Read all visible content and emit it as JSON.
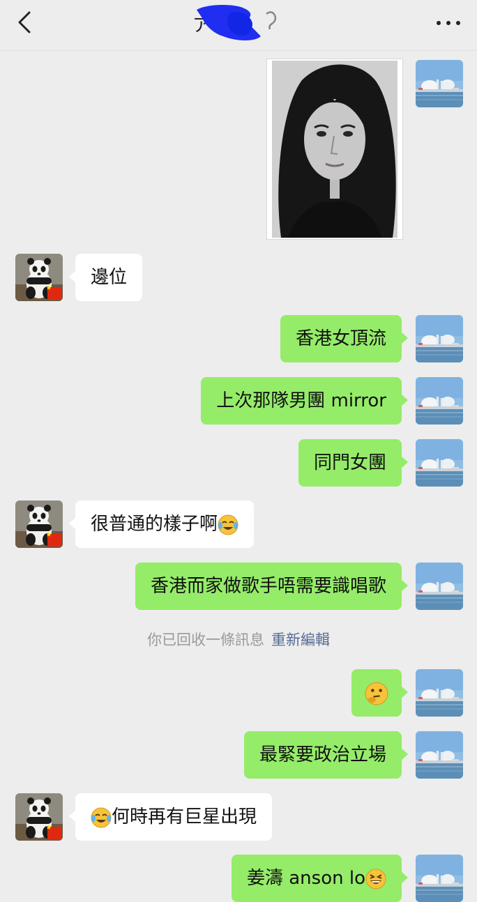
{
  "header": {
    "title_fragment": "ア",
    "back_icon": "chevron-left-icon",
    "ear_icon": "ear-icon",
    "more_icon": "more-dots-icon"
  },
  "messages": [
    {
      "side": "me",
      "type": "image",
      "content": "photo of a woman"
    },
    {
      "side": "other",
      "type": "text",
      "text": "邊位"
    },
    {
      "side": "me",
      "type": "text",
      "text": "香港女頂流"
    },
    {
      "side": "me",
      "type": "text",
      "text": "上次那隊男團 mirror"
    },
    {
      "side": "me",
      "type": "text",
      "text": "同門女團"
    },
    {
      "side": "other",
      "type": "text",
      "text": "很普通的樣子啊",
      "trailing_emoji": "crying-laughing-emoji"
    },
    {
      "side": "me",
      "type": "text",
      "text": "香港而家做歌手唔需要識唱歌"
    },
    {
      "side": "me",
      "type": "emoji",
      "emoji": "thinking-emoji"
    },
    {
      "side": "me",
      "type": "text",
      "text": "最緊要政治立場"
    },
    {
      "side": "other",
      "type": "text",
      "text": "何時再有巨星出現",
      "leading_emoji": "crying-laughing-emoji"
    },
    {
      "side": "me",
      "type": "text",
      "text": "姜濤 anson lo",
      "trailing_emoji": "grinning-squint-emoji"
    }
  ],
  "system": {
    "recall_text": "你已回收一條訊息",
    "re_edit_label": "重新編輯"
  },
  "colors": {
    "background": "#ededed",
    "my_bubble": "#95ec69",
    "their_bubble": "#ffffff",
    "link": "#576b95"
  }
}
